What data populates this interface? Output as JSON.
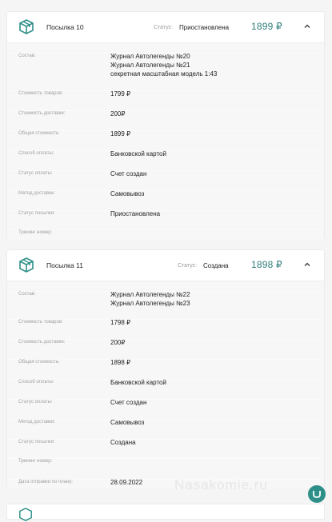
{
  "parcels": [
    {
      "title": "Посылка 10",
      "status_label": "Статус:",
      "status_value": "Приостановлена",
      "price": "1899 ₽",
      "rows": [
        {
          "label": "Состав:",
          "lines": [
            "Журнал Автолегенды №20",
            "Журнал Автолегенды №21",
            "секретная масштабная модель 1:43"
          ]
        },
        {
          "label": "Стоимость товаров:",
          "lines": [
            "1799 ₽"
          ]
        },
        {
          "label": "Стоимость доставки:",
          "lines": [
            "200₽"
          ]
        },
        {
          "label": "Общая стоимость:",
          "lines": [
            "1899 ₽"
          ]
        },
        {
          "label": "Способ оплаты:",
          "lines": [
            "Банковской картой"
          ]
        },
        {
          "label": "Статус оплаты:",
          "lines": [
            "Счет создан"
          ]
        },
        {
          "label": "Метод доставки:",
          "lines": [
            "Самовывоз"
          ]
        },
        {
          "label": "Статус посылки:",
          "lines": [
            "Приостановлена"
          ]
        },
        {
          "label": "Трекинг номер:",
          "lines": [
            ""
          ]
        }
      ]
    },
    {
      "title": "Посылка 11",
      "status_label": "Статус:",
      "status_value": "Создана",
      "price": "1898 ₽",
      "rows": [
        {
          "label": "Состав:",
          "lines": [
            "Журнал Автолегенды №22",
            "Журнал Автолегенды №23"
          ]
        },
        {
          "label": "Стоимость товаров:",
          "lines": [
            "1798 ₽"
          ]
        },
        {
          "label": "Стоимость доставки:",
          "lines": [
            "200₽"
          ]
        },
        {
          "label": "Общая стоимость:",
          "lines": [
            "1898 ₽"
          ]
        },
        {
          "label": "Способ оплаты:",
          "lines": [
            "Банковской картой"
          ]
        },
        {
          "label": "Статус оплаты:",
          "lines": [
            "Счет создан"
          ]
        },
        {
          "label": "Метод доставки:",
          "lines": [
            "Самовывоз"
          ]
        },
        {
          "label": "Статус посылки:",
          "lines": [
            "Создана"
          ]
        },
        {
          "label": "Трекинг номер:",
          "lines": [
            ""
          ]
        },
        {
          "label": "Дата отправки по плану:",
          "lines": [
            "28.09.2022"
          ]
        }
      ]
    }
  ],
  "watermark": "Nasakomie.ru",
  "icons": {
    "parcel": "box-icon",
    "toggle": "chevron-up-icon",
    "chat": "chat-icon"
  },
  "colors": {
    "accent": "#2e7d78"
  }
}
